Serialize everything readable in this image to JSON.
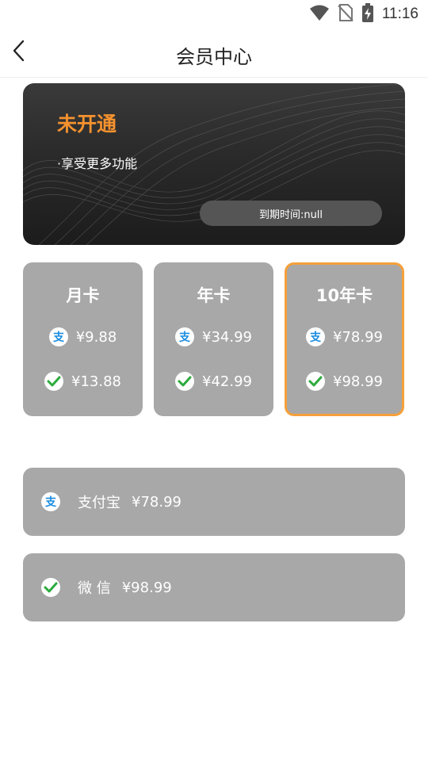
{
  "status_bar": {
    "time": "11:16"
  },
  "app_bar": {
    "title": "会员中心"
  },
  "member_card": {
    "status": "未开通",
    "description": "·享受更多功能",
    "expire_text": "到期时间:null"
  },
  "plans": [
    {
      "name": "月卡",
      "alipay_price": "¥9.88",
      "wechat_price": "¥13.88",
      "selected": false
    },
    {
      "name": "年卡",
      "alipay_price": "¥34.99",
      "wechat_price": "¥42.99",
      "selected": false
    },
    {
      "name": "10年卡",
      "alipay_price": "¥78.99",
      "wechat_price": "¥98.99",
      "selected": true
    }
  ],
  "payment": {
    "alipay": {
      "label": "支付宝",
      "price": "¥78.99",
      "icon": "alipay-icon"
    },
    "wechat": {
      "label": "微 信",
      "price": "¥98.99",
      "icon": "wechat-icon"
    }
  },
  "colors": {
    "accent": "#f5922e",
    "selected_border": "#f5a03a",
    "card_bg": "#a8a8a8",
    "alipay_blue": "#1a8ce0",
    "wechat_green": "#2bab3c"
  }
}
